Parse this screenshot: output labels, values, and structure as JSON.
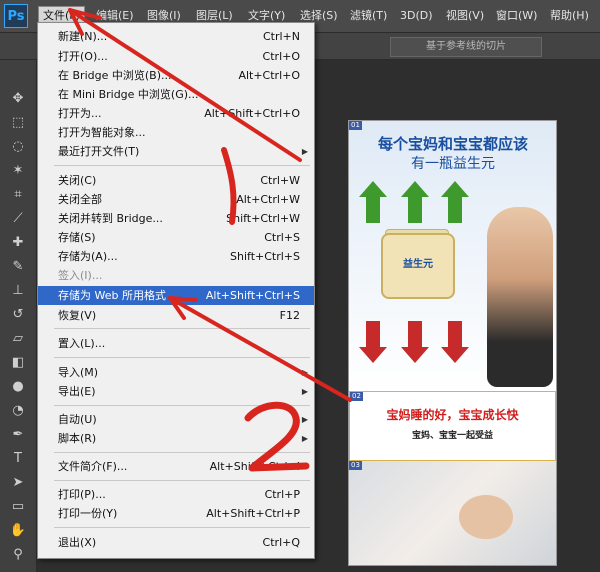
{
  "app": {
    "logo": "Ps"
  },
  "menubar": {
    "items": [
      {
        "label": "文件(F)",
        "x": 0
      },
      {
        "label": "编辑(E)"
      },
      {
        "label": "图像(I)"
      },
      {
        "label": "图层(L)"
      },
      {
        "label": "文字(Y)"
      },
      {
        "label": "选择(S)"
      },
      {
        "label": "滤镜(T)"
      },
      {
        "label": "3D(D)"
      },
      {
        "label": "视图(V)"
      },
      {
        "label": "窗口(W)"
      },
      {
        "label": "帮助(H)"
      }
    ]
  },
  "optionsbar": {
    "slice_button": "基于参考线的切片"
  },
  "file_menu": {
    "items": [
      {
        "label": "新建(N)...",
        "shortcut": "Ctrl+N"
      },
      {
        "label": "打开(O)...",
        "shortcut": "Ctrl+O"
      },
      {
        "label": "在 Bridge 中浏览(B)...",
        "shortcut": "Alt+Ctrl+O"
      },
      {
        "label": "在 Mini Bridge 中浏览(G)..."
      },
      {
        "label": "打开为...",
        "shortcut": "Alt+Shift+Ctrl+O"
      },
      {
        "label": "打开为智能对象..."
      },
      {
        "label": "最近打开文件(T)"
      },
      {
        "label": "关闭(C)",
        "shortcut": "Ctrl+W"
      },
      {
        "label": "关闭全部",
        "shortcut": "Alt+Ctrl+W"
      },
      {
        "label": "关闭并转到 Bridge...",
        "shortcut": "Shift+Ctrl+W"
      },
      {
        "label": "存储(S)",
        "shortcut": "Ctrl+S"
      },
      {
        "label": "存储为(A)...",
        "shortcut": "Shift+Ctrl+S"
      },
      {
        "label": "签入(I)..."
      },
      {
        "label": "存储为 Web 所用格式",
        "shortcut": "Alt+Shift+Ctrl+S"
      },
      {
        "label": "恢复(V)",
        "shortcut": "F12"
      },
      {
        "label": "置入(L)..."
      },
      {
        "label": "导入(M)"
      },
      {
        "label": "导出(E)"
      },
      {
        "label": "自动(U)"
      },
      {
        "label": "脚本(R)"
      },
      {
        "label": "文件简介(F)...",
        "shortcut": "Alt+Shift+Ctrl+I"
      },
      {
        "label": "打印(P)...",
        "shortcut": "Ctrl+P"
      },
      {
        "label": "打印一份(Y)",
        "shortcut": "Alt+Shift+Ctrl+P"
      },
      {
        "label": "退出(X)",
        "shortcut": "Ctrl+Q"
      }
    ]
  },
  "document": {
    "slice_tags": [
      "01",
      "02",
      "03"
    ],
    "headline1": "每个宝妈和宝宝都应该",
    "headline2": "有一瓶益生元",
    "jar_label": "益生元",
    "mid_line1": "宝妈睡的好，宝宝成长快",
    "mid_line2": "宝妈、宝宝一起受益"
  },
  "annotations": {
    "mark1": "1",
    "mark2": "2",
    "color": "#d8261f"
  },
  "colors": {
    "highlight": "#2f68c8",
    "menubar": "#4a4a4a",
    "menu_bg": "#f0f0f0"
  }
}
